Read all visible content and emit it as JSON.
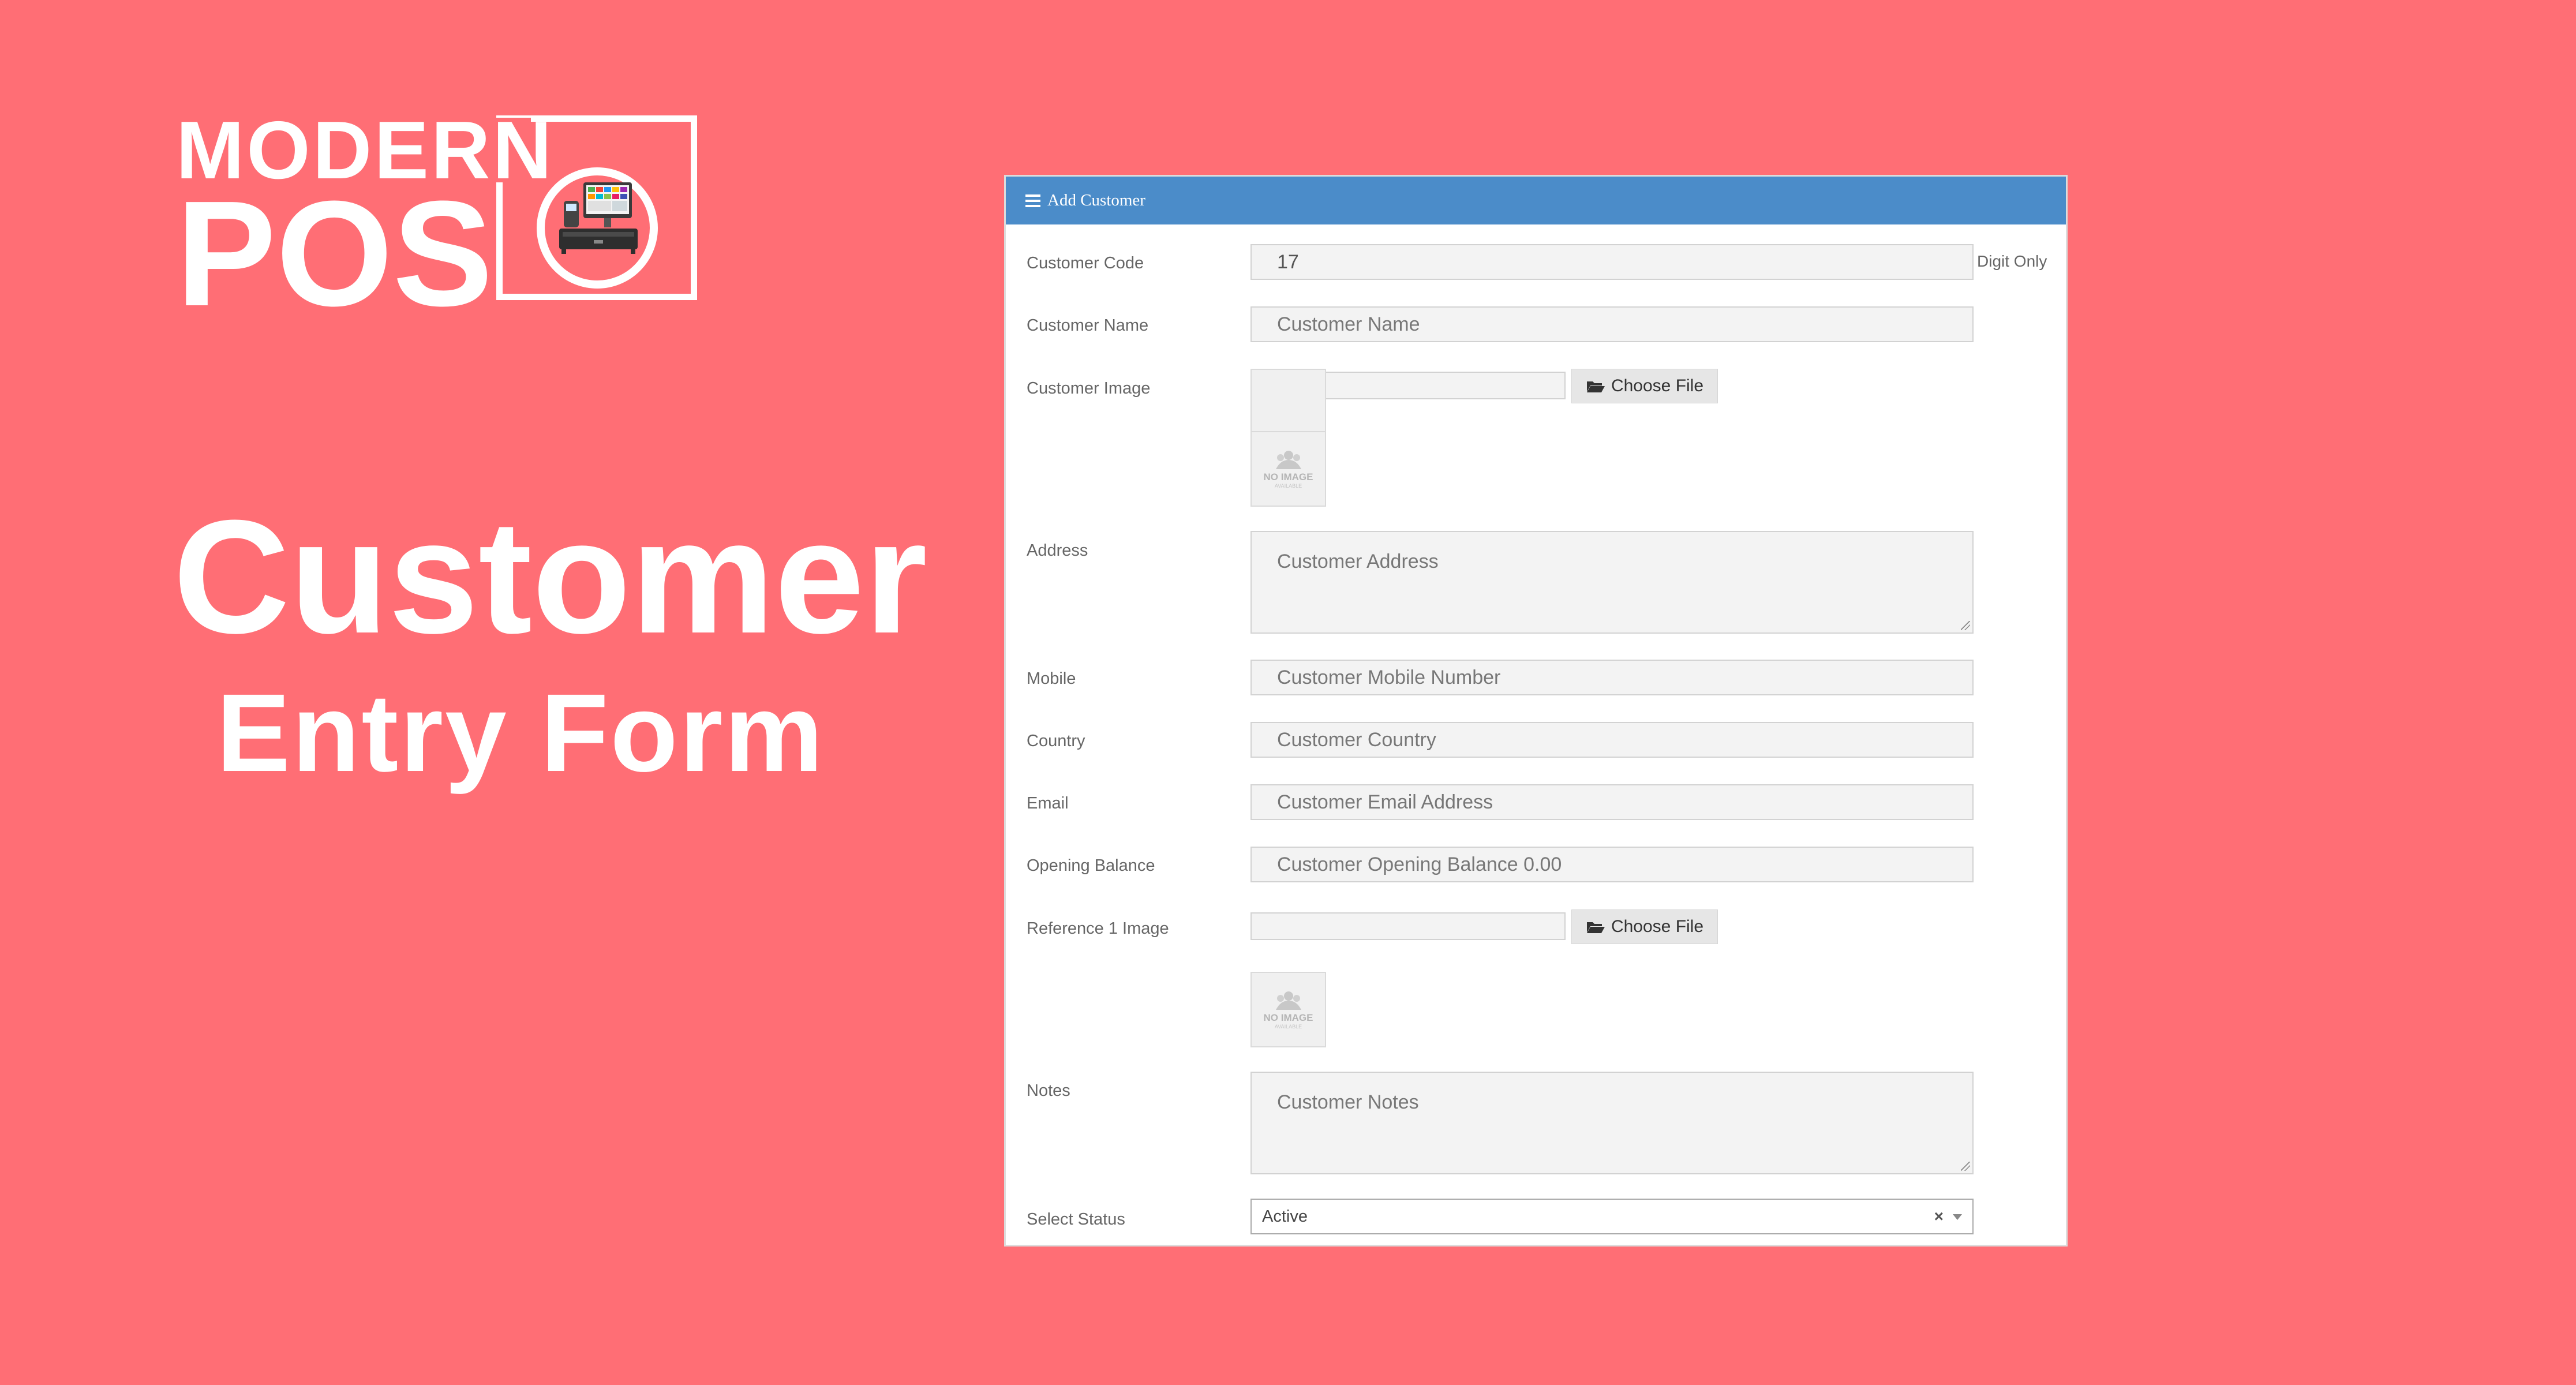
{
  "colors": {
    "background": "#ff6e75",
    "panel_header": "#4b8cc9",
    "text_white": "#ffffff"
  },
  "brand": {
    "line1": "MODERN",
    "line2": "POS",
    "icon": "pos-terminal-icon"
  },
  "hero": {
    "title": "Customer",
    "subtitle": "Entry Form"
  },
  "form": {
    "header": {
      "icon": "hamburger-icon",
      "title": "Add Customer"
    },
    "fields": {
      "code": {
        "label": "Customer Code",
        "value": "17",
        "hint": "Digit Only"
      },
      "name": {
        "label": "Customer Name",
        "placeholder": "Customer Name"
      },
      "image": {
        "label": "Customer Image",
        "button": "Choose File",
        "preview_text": "NO IMAGE",
        "preview_sub": "AVAILABLE"
      },
      "address": {
        "label": "Address",
        "placeholder": "Customer Address"
      },
      "mobile": {
        "label": "Mobile",
        "placeholder": "Customer Mobile Number"
      },
      "country": {
        "label": "Country",
        "placeholder": "Customer Country"
      },
      "email": {
        "label": "Email",
        "placeholder": "Customer Email Address"
      },
      "opening_balance": {
        "label": "Opening Balance",
        "placeholder": "Customer Opening Balance 0.00"
      },
      "reference_image": {
        "label": "Reference 1 Image",
        "button": "Choose File",
        "preview_text": "NO IMAGE",
        "preview_sub": "AVAILABLE"
      },
      "notes": {
        "label": "Notes",
        "placeholder": "Customer Notes"
      },
      "status": {
        "label": "Select Status",
        "value": "Active",
        "clear": "×"
      }
    }
  }
}
